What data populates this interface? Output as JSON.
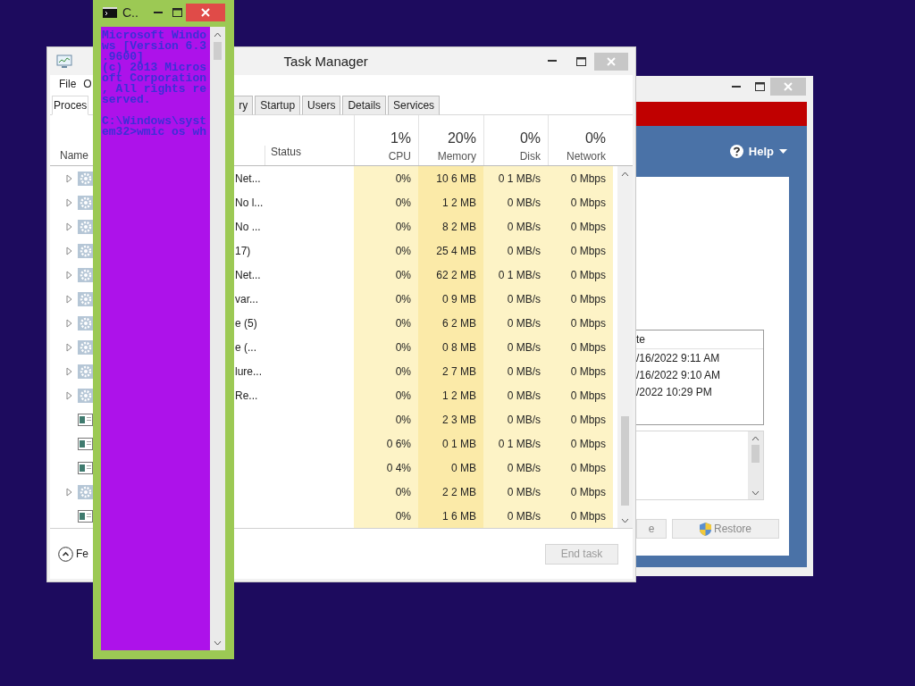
{
  "cmd_window": {
    "title": "C..",
    "paragraphs": [
      [
        "Microsoft Windo",
        "ws [Version 6.3",
        ".9600]",
        "(c) 2013 Micros",
        "oft Corporation",
        ", All rights re",
        "served."
      ],
      [
        "C:\\Windows\\syst",
        "em32>wmic os wh"
      ]
    ]
  },
  "task_manager": {
    "title": "Task Manager",
    "menu": [
      "File",
      "O"
    ],
    "tabs": [
      {
        "label": "Proces",
        "selected": true
      },
      {
        "label": "ry",
        "selected": false
      },
      {
        "label": "Startup",
        "selected": false
      },
      {
        "label": "Users",
        "selected": false
      },
      {
        "label": "Details",
        "selected": false
      },
      {
        "label": "Services",
        "selected": false
      }
    ],
    "columns": {
      "name": "Name",
      "status": "Status",
      "metrics": [
        {
          "percent": "1%",
          "label": "CPU"
        },
        {
          "percent": "20%",
          "label": "Memory"
        },
        {
          "percent": "0%",
          "label": "Disk"
        },
        {
          "percent": "0%",
          "label": "Network"
        }
      ]
    },
    "rows": [
      {
        "expandable": true,
        "kind": "service",
        "name": "Net...",
        "values": [
          "0%",
          "10 6 MB",
          "0 1 MB/s",
          "0 Mbps"
        ]
      },
      {
        "expandable": true,
        "kind": "service",
        "name": "No l...",
        "values": [
          "0%",
          "1 2 MB",
          "0 MB/s",
          "0 Mbps"
        ]
      },
      {
        "expandable": true,
        "kind": "service",
        "name": "No ...",
        "values": [
          "0%",
          "8 2 MB",
          "0 MB/s",
          "0 Mbps"
        ]
      },
      {
        "expandable": true,
        "kind": "service",
        "name": "17)",
        "values": [
          "0%",
          "25 4 MB",
          "0 MB/s",
          "0 Mbps"
        ]
      },
      {
        "expandable": true,
        "kind": "service",
        "name": "Net...",
        "values": [
          "0%",
          "62 2 MB",
          "0 1 MB/s",
          "0 Mbps"
        ]
      },
      {
        "expandable": true,
        "kind": "service",
        "name": "var...",
        "values": [
          "0%",
          "0 9 MB",
          "0 MB/s",
          "0 Mbps"
        ]
      },
      {
        "expandable": true,
        "kind": "service",
        "name": "e (5)",
        "values": [
          "0%",
          "6 2 MB",
          "0 MB/s",
          "0 Mbps"
        ]
      },
      {
        "expandable": true,
        "kind": "service",
        "name": "e (...",
        "values": [
          "0%",
          "0 8 MB",
          "0 MB/s",
          "0 Mbps"
        ]
      },
      {
        "expandable": true,
        "kind": "service",
        "name": "lure...",
        "values": [
          "0%",
          "2 7 MB",
          "0 MB/s",
          "0 Mbps"
        ]
      },
      {
        "expandable": true,
        "kind": "service",
        "name": "Re...",
        "values": [
          "0%",
          "1 2 MB",
          "0 MB/s",
          "0 Mbps"
        ]
      },
      {
        "expandable": false,
        "kind": "app",
        "values": [
          "0%",
          "2 3 MB",
          "0 MB/s",
          "0 Mbps"
        ]
      },
      {
        "expandable": false,
        "kind": "app",
        "values": [
          "0 6%",
          "0 1 MB",
          "0 1 MB/s",
          "0 Mbps"
        ]
      },
      {
        "expandable": false,
        "kind": "app",
        "values": [
          "0 4%",
          "0 MB",
          "0 MB/s",
          "0 Mbps"
        ]
      },
      {
        "expandable": true,
        "kind": "service",
        "values": [
          "0%",
          "2 2 MB",
          "0 MB/s",
          "0 Mbps"
        ]
      },
      {
        "expandable": false,
        "kind": "app",
        "values": [
          "0%",
          "1 6 MB",
          "0 MB/s",
          "0 Mbps"
        ]
      }
    ],
    "footer": {
      "toggle": "Fe",
      "end_task": {
        "label": "End task",
        "disabled": true
      }
    }
  },
  "restore_window": {
    "help": "Help",
    "list_header": "te",
    "entries": [
      "/16/2022 9:11 AM",
      "/16/2022 9:10 AM",
      "/2022 10:29 PM"
    ],
    "buttons": [
      {
        "label": "e",
        "shield": false
      },
      {
        "label": "Restore",
        "shield": true
      }
    ]
  }
}
